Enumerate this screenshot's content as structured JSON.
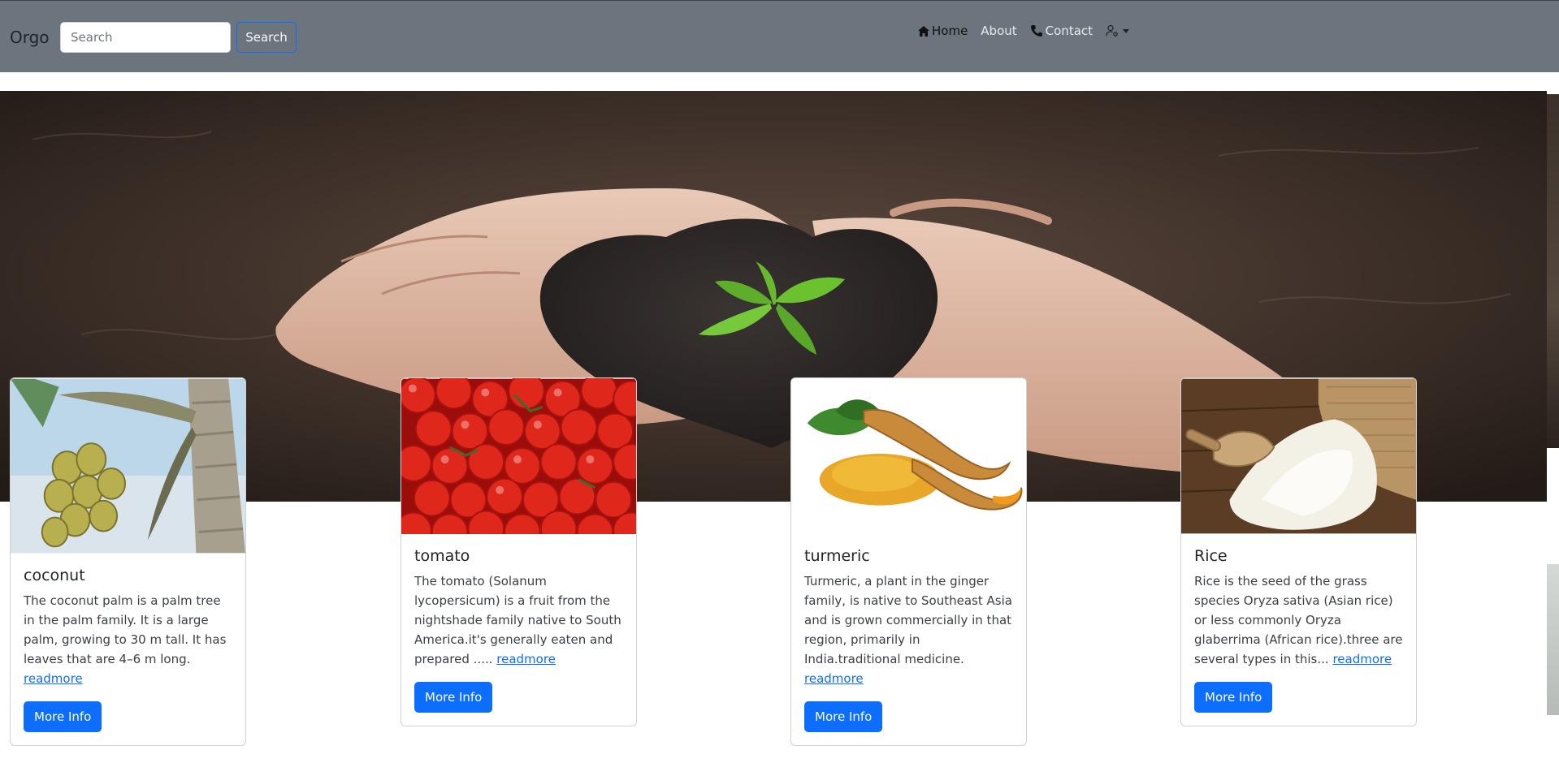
{
  "navbar": {
    "brand": "Orgo",
    "search_placeholder": "Search",
    "search_button": "Search",
    "links": [
      {
        "label": "Home",
        "icon": "home-icon",
        "active": true
      },
      {
        "label": "About",
        "icon": "",
        "active": false
      },
      {
        "label": "Contact",
        "icon": "phone-icon",
        "active": false
      }
    ],
    "user_menu_icon": "user-gear-icon"
  },
  "hero": {
    "image": "hands-holding-heart-shaped-soil-with-seedling"
  },
  "cards": [
    {
      "title": "coconut",
      "text": "The coconut palm is a palm tree in the palm family. It is a large palm, growing to 30 m tall. It has leaves that are 4–6 m long.",
      "link": "readmore",
      "button": "More Info"
    },
    {
      "title": "tomato",
      "text": "The tomato (Solanum lycopersicum) is a fruit from the nightshade family native to South America.it's generally eaten and prepared .....",
      "link": "readmore",
      "button": "More Info"
    },
    {
      "title": "turmeric",
      "text": "Turmeric, a plant in the ginger family, is native to Southeast Asia and is grown commercially in that region, primarily in India.traditional medicine.",
      "link": "readmore",
      "button": "More Info"
    },
    {
      "title": "Rice",
      "text": "Rice is the seed of the grass species Oryza sativa (Asian rice) or less commonly Oryza glaberrima (African rice).three are several types in this...",
      "link": "readmore",
      "button": "More Info"
    }
  ]
}
